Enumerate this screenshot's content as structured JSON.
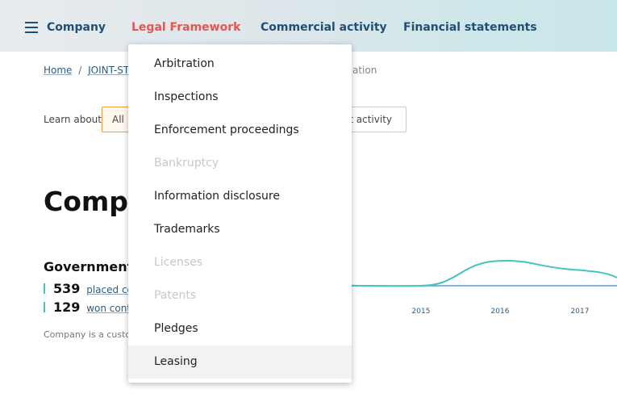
{
  "nav": {
    "items": [
      {
        "label": "Company",
        "active": false
      },
      {
        "label": "Legal Framework",
        "active": true
      },
      {
        "label": "Commercial activity",
        "active": false
      },
      {
        "label": "Financial statements",
        "active": false
      }
    ]
  },
  "breadcrumb": {
    "home": "Home",
    "separator": "/",
    "company": "JOINT-STO",
    "tail": "ation"
  },
  "filters": {
    "label": "Learn about",
    "chips": [
      {
        "label": "All",
        "selected": true
      },
      {
        "label": "st activity",
        "selected": false
      }
    ]
  },
  "main": {
    "title": "Compa",
    "gov_heading": "Government c",
    "stats": [
      {
        "value": "539",
        "label": "placed con"
      },
      {
        "value": "129",
        "label": "won contra"
      }
    ],
    "note": "Company is a custo"
  },
  "chart_data": {
    "type": "area",
    "x": [
      "2015",
      "2016",
      "2017"
    ],
    "title": "",
    "xlabel": "",
    "ylabel": "",
    "grid": false,
    "legend": "none",
    "colors": {
      "line": "#45c4bf",
      "baseline": "#5b9bd5"
    }
  },
  "dropdown": {
    "items": [
      {
        "label": "Arbitration",
        "disabled": false,
        "hover": false
      },
      {
        "label": "Inspections",
        "disabled": false,
        "hover": false
      },
      {
        "label": "Enforcement proceedings",
        "disabled": false,
        "hover": false
      },
      {
        "label": "Bankruptcy",
        "disabled": true,
        "hover": false
      },
      {
        "label": "Information disclosure",
        "disabled": false,
        "hover": false
      },
      {
        "label": "Trademarks",
        "disabled": false,
        "hover": false
      },
      {
        "label": "Licenses",
        "disabled": true,
        "hover": false
      },
      {
        "label": "Patents",
        "disabled": true,
        "hover": false
      },
      {
        "label": "Pledges",
        "disabled": false,
        "hover": false
      },
      {
        "label": "Leasing",
        "disabled": false,
        "hover": true
      }
    ]
  },
  "colors": {
    "accent_active": "#e8554e",
    "nav_text": "#1f4f78",
    "teal": "#45c4bf"
  }
}
